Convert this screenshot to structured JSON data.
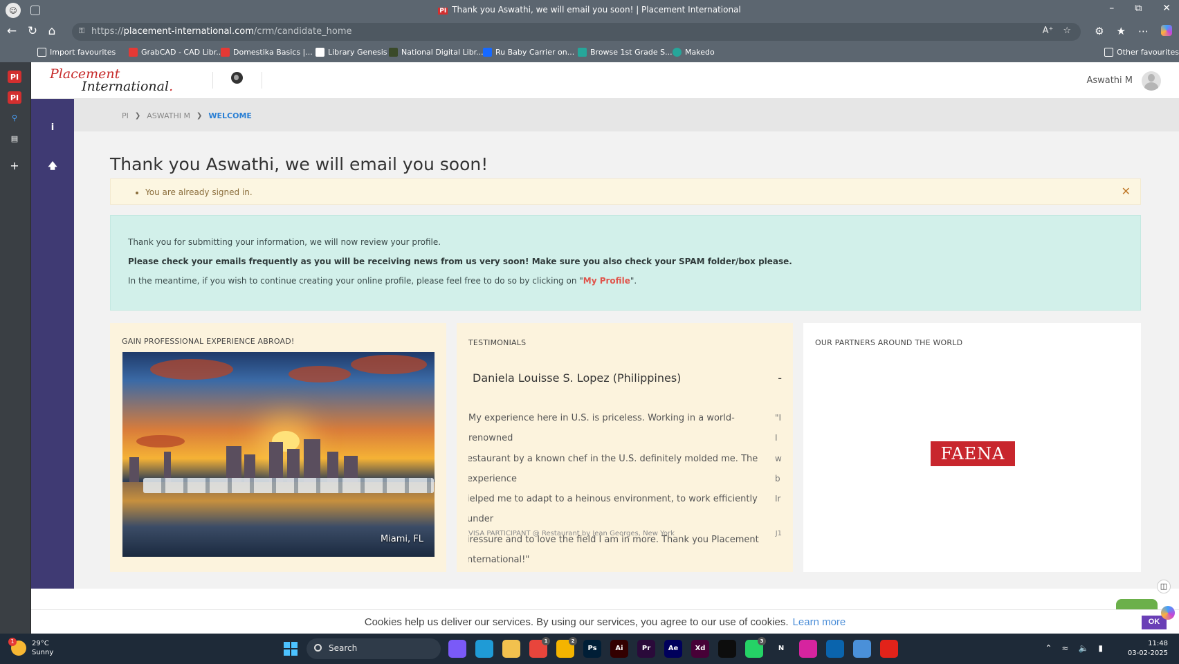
{
  "browser": {
    "tab_title": "Thank you Aswathi, we will email you soon! | Placement International",
    "tab_favicon": "PI",
    "url_scheme": "https://",
    "url_host": "placement-international.com",
    "url_path": "/crm/candidate_home",
    "bookmarks": [
      {
        "label": "Import favourites",
        "icon": "import-icon",
        "color": "#ffffff"
      },
      {
        "label": "GrabCAD - CAD Libr...",
        "icon": "grabcad-icon",
        "color": "#e53935"
      },
      {
        "label": "Domestika Basics |...",
        "icon": "domestika-icon",
        "color": "#e53935"
      },
      {
        "label": "Library Genesis",
        "icon": "libgen-icon",
        "color": "#ffffff"
      },
      {
        "label": "National Digital Libr...",
        "icon": "ndl-icon",
        "color": "#3a4a2a"
      },
      {
        "label": "Ru Baby Carrier on...",
        "icon": "behance-icon",
        "color": "#1769ff"
      },
      {
        "label": "Browse 1st Grade S...",
        "icon": "tag-icon",
        "color": "#26a69a"
      },
      {
        "label": "Makedo",
        "icon": "makedo-icon",
        "color": "#26a69a"
      }
    ],
    "other_favourites": "Other favourites"
  },
  "site": {
    "logo_line1": "Placement",
    "logo_line2": "International",
    "logo_dot": ".",
    "user_name": "Aswathi M",
    "breadcrumb": [
      "PI",
      "ASWATHI M",
      "WELCOME"
    ]
  },
  "main": {
    "title": "Thank you Aswathi, we will email you soon!",
    "warning": "You are already signed in.",
    "info_p1": "Thank you for submitting your information, we will now review your profile.",
    "info_p2": "Please check your emails frequently as you will be receiving news from us very soon! Make sure you also check your SPAM folder/box please.",
    "info_p3_before": "In the meantime, if you wish to continue creating your online profile, please feel free to do so by clicking on \"",
    "info_p3_link": "My Profile",
    "info_p3_after": "\"."
  },
  "cards": {
    "experience_title": "GAIN PROFESSIONAL EXPERIENCE ABROAD!",
    "photo_caption": "Miami, FL",
    "testimonials_title": "TESTIMONIALS",
    "testimonial_name": "Daniela Louisse S. Lopez (Philippines)",
    "testimonial_dash": "-",
    "testimonial_lines": [
      "My experience here in U.S. is priceless. Working in a world-renowned",
      "estaurant by a known chef in the U.S. definitely molded me. The experience",
      "ielped me to adapt to a heinous environment, to work efficiently under",
      "iressure and to love the field I am in more. Thank you Placement",
      "nternational!\""
    ],
    "testimonial_peek": [
      "\"I",
      "I",
      "w",
      "b",
      "Ir"
    ],
    "testimonial_footer": "VISA PARTICIPANT @ Restaurant by Jean Georges, New York",
    "testimonial_footer_peek": "J1",
    "partners_title": "OUR PARTNERS AROUND THE WORLD",
    "partner_logo": "FAENA"
  },
  "cookie": {
    "text": "Cookies help us deliver our services. By using our services, you agree to our use of cookies.",
    "learn_more": "Learn more",
    "ok": "OK"
  },
  "taskbar": {
    "weather_temp": "29°C",
    "weather_desc": "Sunny",
    "weather_badge": "1",
    "search": "Search",
    "time": "11:48",
    "date": "03-02-2025",
    "apps": [
      {
        "name": "copilot-app-icon",
        "label": "",
        "bg": "#7a5af8"
      },
      {
        "name": "edge-app-icon",
        "label": "",
        "bg": "#1f9bd6"
      },
      {
        "name": "file-explorer-icon",
        "label": "",
        "bg": "#f2c14e"
      },
      {
        "name": "chrome-app-icon",
        "label": "",
        "bg": "#e8453c",
        "badge": "1"
      },
      {
        "name": "chrome-profile-app-icon",
        "label": "",
        "bg": "#f4b400",
        "badge": "2"
      },
      {
        "name": "photoshop-app-icon",
        "label": "Ps",
        "bg": "#001e36"
      },
      {
        "name": "illustrator-app-icon",
        "label": "Ai",
        "bg": "#330000"
      },
      {
        "name": "premiere-app-icon",
        "label": "Pr",
        "bg": "#2a0a3a"
      },
      {
        "name": "after-effects-app-icon",
        "label": "Ae",
        "bg": "#00005b"
      },
      {
        "name": "xd-app-icon",
        "label": "Xd",
        "bg": "#470137"
      },
      {
        "name": "figma-app-icon",
        "label": "",
        "bg": "#0d0d0d"
      },
      {
        "name": "whatsapp-app-icon",
        "label": "",
        "bg": "#25d366",
        "badge": "3"
      },
      {
        "name": "netflix-app-icon",
        "label": "N",
        "bg": "#1e2a38"
      },
      {
        "name": "instagram-app-icon",
        "label": "",
        "bg": "#d6249f"
      },
      {
        "name": "outlook-app-icon",
        "label": "",
        "bg": "#0a64ad"
      },
      {
        "name": "notepad-app-icon",
        "label": "",
        "bg": "#4a90d9"
      },
      {
        "name": "acrobat-app-icon",
        "label": "",
        "bg": "#e2231a"
      }
    ]
  }
}
